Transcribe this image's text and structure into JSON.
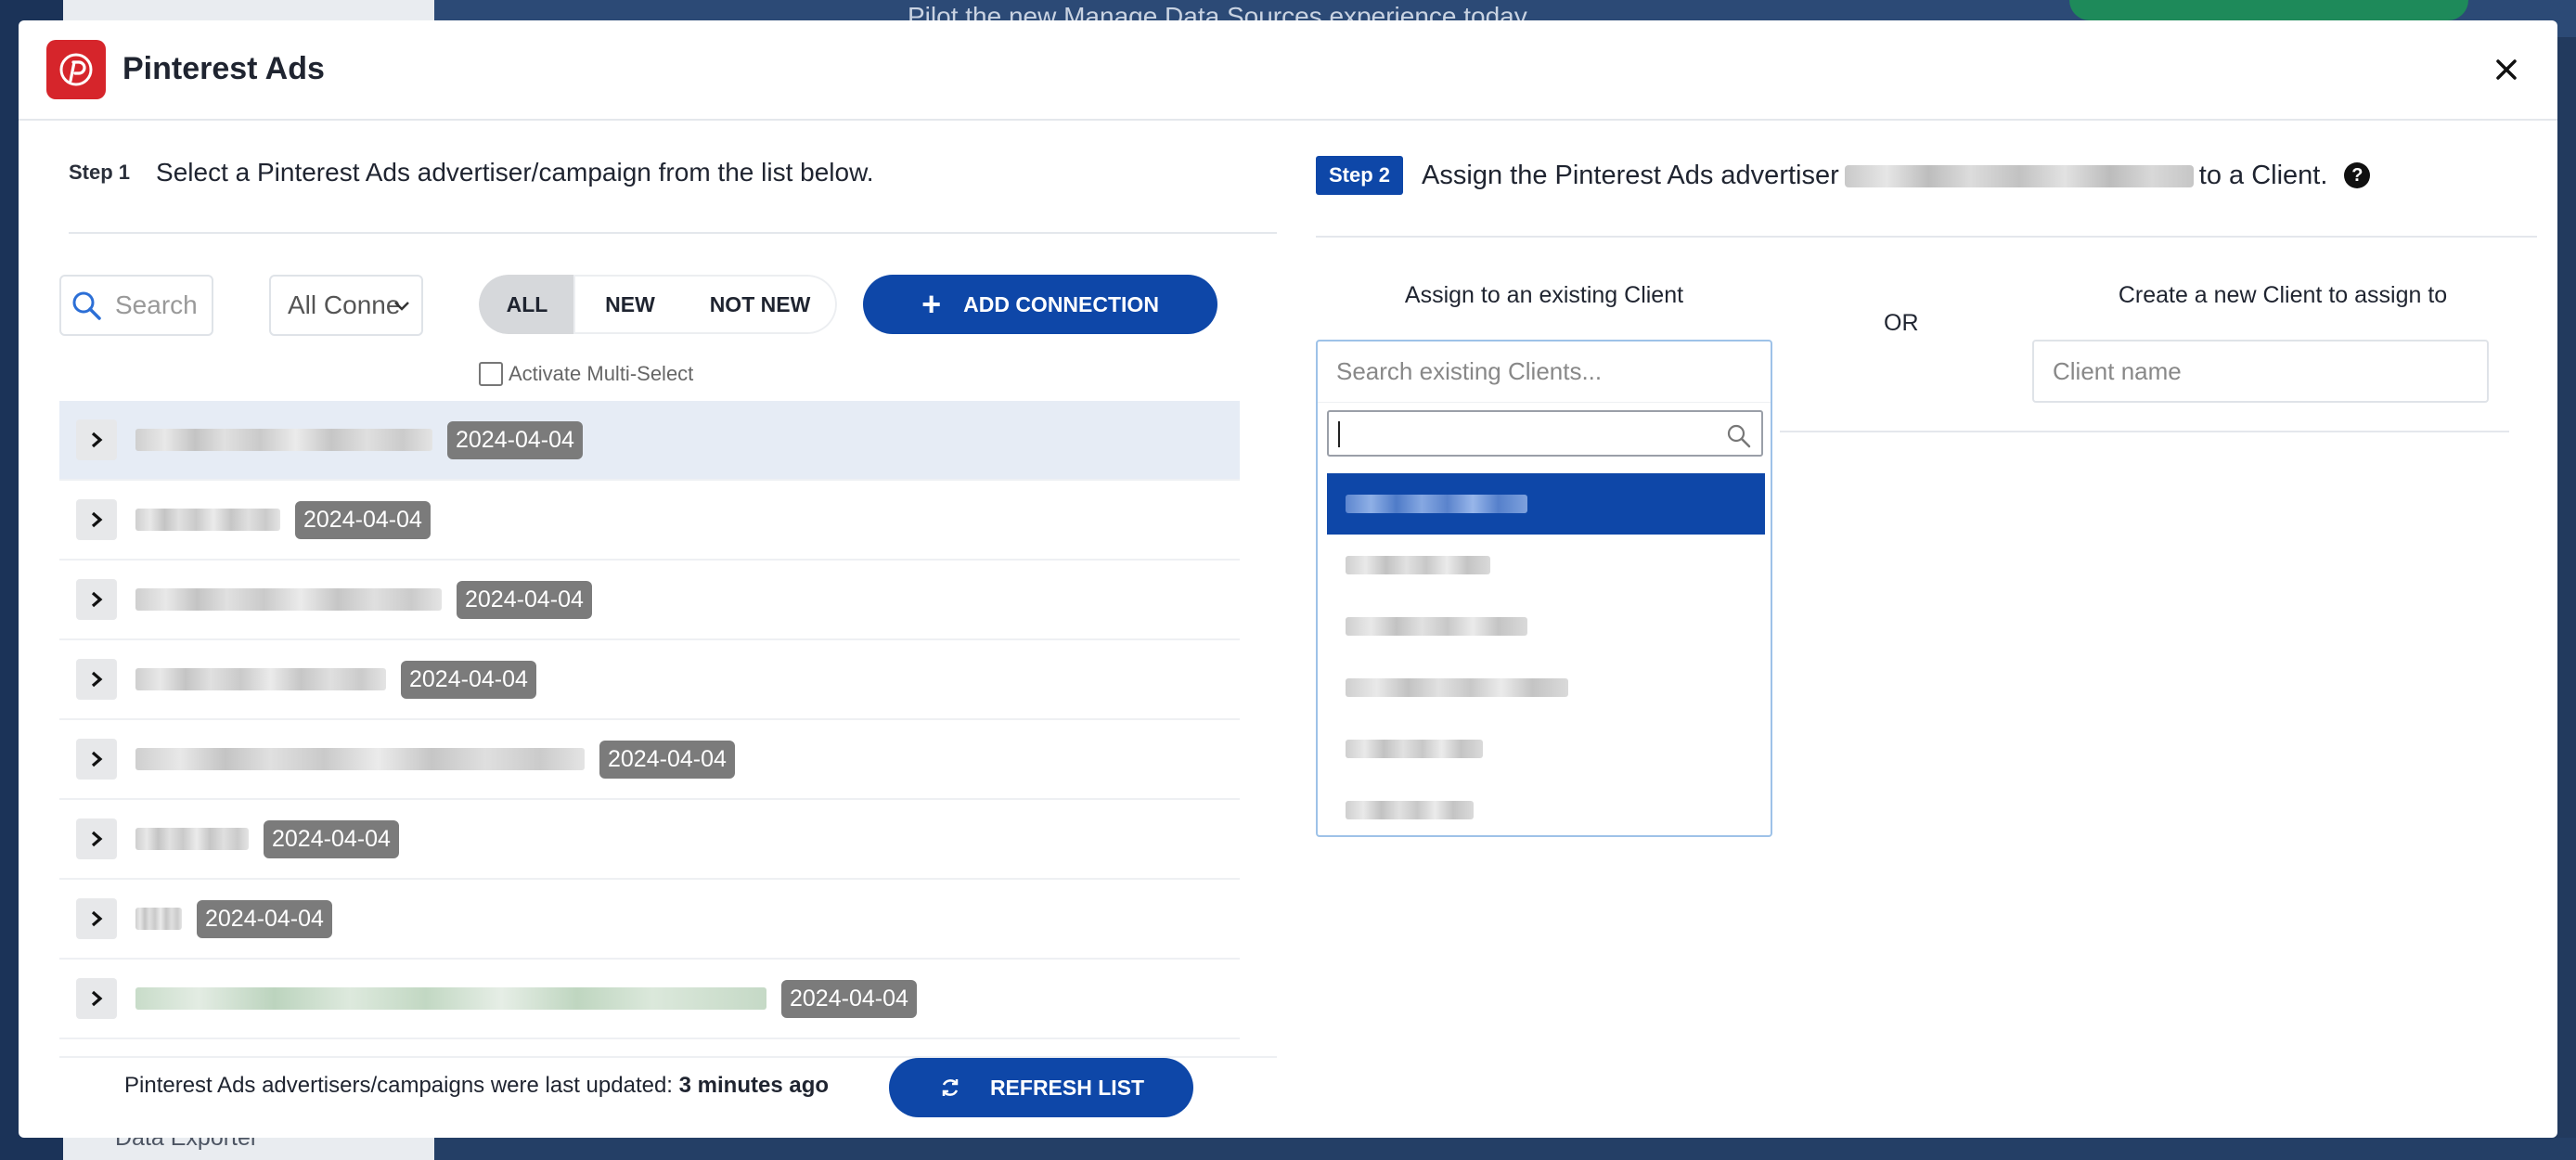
{
  "background": {
    "banner_text": "Pilot the new Manage Data Sources experience today",
    "sidebar_bottom_label": "Data Exporter"
  },
  "modal": {
    "title": "Pinterest Ads",
    "close_icon": "close-icon",
    "logo_icon": "pinterest-logo-icon",
    "brand_color": "#d6252b"
  },
  "step1": {
    "badge": "Step 1",
    "instruction": "Select a Pinterest Ads advertiser/campaign from the list below."
  },
  "step2": {
    "badge": "Step 2",
    "text_before": "Assign the Pinterest Ads advertiser",
    "text_after": "to a Client.",
    "help": "?"
  },
  "filters": {
    "search_placeholder": "Search",
    "connection_select": "All Conne",
    "toggle_options": [
      "ALL",
      "NEW",
      "NOT NEW"
    ],
    "active_toggle": "ALL",
    "add_connection_label": "ADD CONNECTION",
    "multi_select_label": "Activate Multi-Select"
  },
  "list": {
    "rows": [
      {
        "date": "2024-04-04",
        "selected": true
      },
      {
        "date": "2024-04-04",
        "selected": false
      },
      {
        "date": "2024-04-04",
        "selected": false
      },
      {
        "date": "2024-04-04",
        "selected": false
      },
      {
        "date": "2024-04-04",
        "selected": false
      },
      {
        "date": "2024-04-04",
        "selected": false
      },
      {
        "date": "2024-04-04",
        "selected": false
      },
      {
        "date": "2024-04-04",
        "selected": false
      }
    ]
  },
  "footer": {
    "last_updated_prefix": "Pinterest Ads advertisers/campaigns were last updated:",
    "last_updated_value": "3 minutes ago",
    "refresh_label": "REFRESH LIST"
  },
  "assign": {
    "existing_label": "Assign to an existing Client",
    "existing_placeholder": "Search existing Clients...",
    "or_label": "OR",
    "create_label": "Create a new Client to assign to",
    "client_name_placeholder": "Client name",
    "dropdown_search_value": "",
    "accent_color": "#0e47a8"
  }
}
